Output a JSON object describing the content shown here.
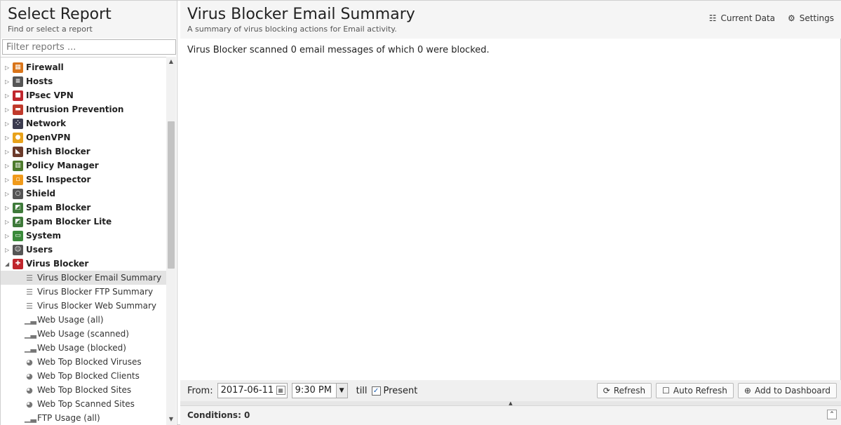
{
  "sidebar": {
    "title": "Select Report",
    "subtitle": "Find or select a report",
    "filter_placeholder": "Filter reports ...",
    "categories": [
      {
        "label": "Firewall",
        "color": "#d9751a",
        "icon": "firewall-icon"
      },
      {
        "label": "Hosts",
        "color": "#555555",
        "icon": "hosts-icon"
      },
      {
        "label": "IPsec VPN",
        "color": "#c0262d",
        "icon": "lock-icon"
      },
      {
        "label": "Intrusion Prevention",
        "color": "#c0392b",
        "icon": "intrusion-prevention-icon"
      },
      {
        "label": "Network",
        "color": "#3b3b4f",
        "icon": "network-icon"
      },
      {
        "label": "OpenVPN",
        "color": "#e8a21a",
        "icon": "openvpn-icon"
      },
      {
        "label": "Phish Blocker",
        "color": "#6b3a2a",
        "icon": "phish-blocker-icon"
      },
      {
        "label": "Policy Manager",
        "color": "#4d7a2c",
        "icon": "policy-manager-icon"
      },
      {
        "label": "SSL Inspector",
        "color": "#f09a1a",
        "icon": "ssl-inspector-icon"
      },
      {
        "label": "Shield",
        "color": "#555555",
        "icon": "shield-icon"
      },
      {
        "label": "Spam Blocker",
        "color": "#3e7a3a",
        "icon": "spam-blocker-icon"
      },
      {
        "label": "Spam Blocker Lite",
        "color": "#3e7a3a",
        "icon": "spam-blocker-lite-icon"
      },
      {
        "label": "System",
        "color": "#3a8a3a",
        "icon": "system-icon"
      },
      {
        "label": "Users",
        "color": "#555555",
        "icon": "users-icon"
      },
      {
        "label": "Virus Blocker",
        "color": "#c0262d",
        "icon": "virus-blocker-icon"
      }
    ],
    "items": [
      {
        "label": "Virus Blocker Email Summary",
        "icon": "text-icon",
        "selected": true
      },
      {
        "label": "Virus Blocker FTP Summary",
        "icon": "text-icon"
      },
      {
        "label": "Virus Blocker Web Summary",
        "icon": "text-icon"
      },
      {
        "label": "Web Usage (all)",
        "icon": "bar-chart-icon"
      },
      {
        "label": "Web Usage (scanned)",
        "icon": "bar-chart-icon"
      },
      {
        "label": "Web Usage (blocked)",
        "icon": "bar-chart-icon"
      },
      {
        "label": "Web Top Blocked Viruses",
        "icon": "pie-chart-icon"
      },
      {
        "label": "Web Top Blocked Clients",
        "icon": "pie-chart-icon"
      },
      {
        "label": "Web Top Blocked Sites",
        "icon": "pie-chart-icon"
      },
      {
        "label": "Web Top Scanned Sites",
        "icon": "pie-chart-icon"
      },
      {
        "label": "FTP Usage (all)",
        "icon": "bar-chart-icon"
      }
    ]
  },
  "report": {
    "title": "Virus Blocker Email Summary",
    "subtitle": "A summary of virus blocking actions for Email activity.",
    "current_data_label": "Current Data",
    "settings_label": "Settings",
    "body_text": "Virus Blocker scanned 0 email messages of which 0 were blocked."
  },
  "bottom": {
    "from_label": "From:",
    "from_date": "2017-06-11",
    "from_time": "9:30 PM",
    "till_label": "till",
    "present_label": "Present",
    "present_checked": true,
    "refresh_label": "Refresh",
    "auto_refresh_label": "Auto Refresh",
    "add_dashboard_label": "Add to Dashboard"
  },
  "conditions": {
    "label": "Conditions: 0"
  }
}
